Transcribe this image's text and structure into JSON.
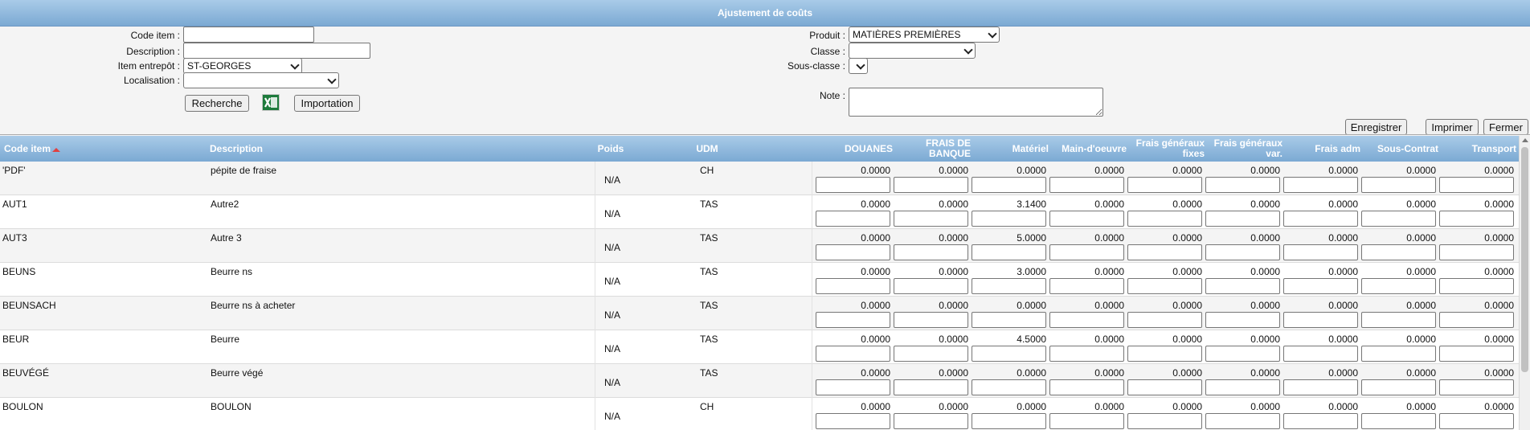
{
  "title": "Ajustement de coûts",
  "filters": {
    "code_item_label": "Code item :",
    "code_item_value": "",
    "description_label": "Description :",
    "description_value": "",
    "item_entrepot_label": "Item entrepôt :",
    "item_entrepot_value": "ST-GEORGES",
    "localisation_label": "Localisation :",
    "localisation_value": "",
    "search_button": "Recherche",
    "import_button": "Importation",
    "produit_label": "Produit :",
    "produit_value": "MATIÈRES PREMIÈRES",
    "classe_label": "Classe :",
    "classe_value": "",
    "sous_classe_label": "Sous-classe :",
    "sous_classe_value": "",
    "note_label": "Note :",
    "note_value": ""
  },
  "actions": {
    "save": "Enregistrer",
    "print": "Imprimer",
    "close": "Fermer"
  },
  "icons": {
    "excel": "excel-icon",
    "sort": "sort-ascending-icon"
  },
  "colors": {
    "header_gradient_top": "#a9cbe8",
    "header_gradient_bottom": "#7ba9d3",
    "sort_arrow": "#e04040",
    "excel_green": "#1e7b3c"
  },
  "columns": {
    "code": "Code item",
    "description": "Description",
    "poids": "Poids",
    "udm": "UDM",
    "douanes": "DOUANES",
    "frais_banque": "FRAIS DE BANQUE",
    "materiel": "Matériel",
    "main_oeuvre": "Main-d'oeuvre",
    "frais_gen_fixes": "Frais généraux fixes",
    "frais_gen_var": "Frais généraux var.",
    "frais_adm": "Frais adm",
    "sous_contrat": "Sous-Contrat",
    "transport": "Transport"
  },
  "rows": [
    {
      "code": "'PDF'",
      "description": "pépite de fraise",
      "poids": "N/A",
      "udm": "CH",
      "costs": [
        "0.0000",
        "0.0000",
        "0.0000",
        "0.0000",
        "0.0000",
        "0.0000",
        "0.0000",
        "0.0000",
        "0.0000"
      ]
    },
    {
      "code": "AUT1",
      "description": "Autre2",
      "poids": "N/A",
      "udm": "TAS",
      "costs": [
        "0.0000",
        "0.0000",
        "3.1400",
        "0.0000",
        "0.0000",
        "0.0000",
        "0.0000",
        "0.0000",
        "0.0000"
      ]
    },
    {
      "code": "AUT3",
      "description": "Autre 3",
      "poids": "N/A",
      "udm": "TAS",
      "costs": [
        "0.0000",
        "0.0000",
        "5.0000",
        "0.0000",
        "0.0000",
        "0.0000",
        "0.0000",
        "0.0000",
        "0.0000"
      ]
    },
    {
      "code": "BEUNS",
      "description": "Beurre ns",
      "poids": "N/A",
      "udm": "TAS",
      "costs": [
        "0.0000",
        "0.0000",
        "3.0000",
        "0.0000",
        "0.0000",
        "0.0000",
        "0.0000",
        "0.0000",
        "0.0000"
      ]
    },
    {
      "code": "BEUNSACH",
      "description": "Beurre ns à acheter",
      "poids": "N/A",
      "udm": "TAS",
      "costs": [
        "0.0000",
        "0.0000",
        "0.0000",
        "0.0000",
        "0.0000",
        "0.0000",
        "0.0000",
        "0.0000",
        "0.0000"
      ]
    },
    {
      "code": "BEUR",
      "description": "Beurre",
      "poids": "N/A",
      "udm": "TAS",
      "costs": [
        "0.0000",
        "0.0000",
        "4.5000",
        "0.0000",
        "0.0000",
        "0.0000",
        "0.0000",
        "0.0000",
        "0.0000"
      ]
    },
    {
      "code": "BEUVÉGÉ",
      "description": "Beurre végé",
      "poids": "N/A",
      "udm": "TAS",
      "costs": [
        "0.0000",
        "0.0000",
        "0.0000",
        "0.0000",
        "0.0000",
        "0.0000",
        "0.0000",
        "0.0000",
        "0.0000"
      ]
    },
    {
      "code": "BOULON",
      "description": "BOULON",
      "poids": "N/A",
      "udm": "CH",
      "costs": [
        "0.0000",
        "0.0000",
        "0.0000",
        "0.0000",
        "0.0000",
        "0.0000",
        "0.0000",
        "0.0000",
        "0.0000"
      ]
    }
  ]
}
